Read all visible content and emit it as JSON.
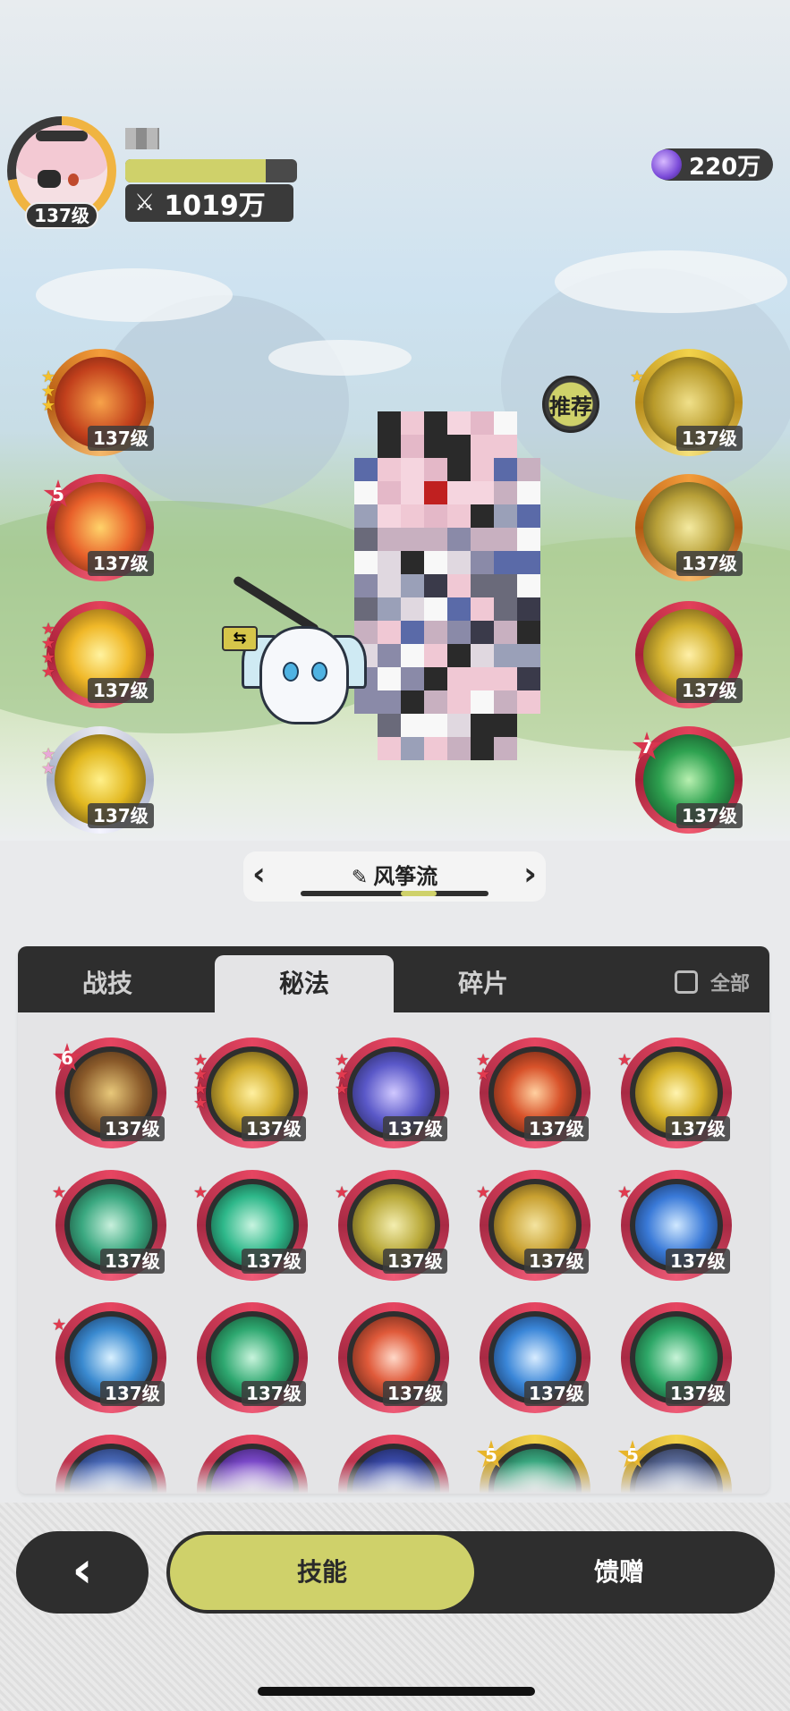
{
  "player": {
    "level": "137级",
    "power": "1019万",
    "exp_fraction": 0.82
  },
  "currency": {
    "amount": "220万",
    "icon": "purple-gem-icon"
  },
  "recommend_label": "推荐",
  "left_skills": [
    {
      "level": "137级",
      "stars": 3,
      "star_color": "gold",
      "badge": ""
    },
    {
      "level": "137级",
      "stars": 0,
      "star_color": "red",
      "badge": "5"
    },
    {
      "level": "137级",
      "stars": 4,
      "star_color": "red",
      "badge": ""
    },
    {
      "level": "137级",
      "stars": 2,
      "star_color": "pink",
      "badge": ""
    }
  ],
  "right_skills": [
    {
      "level": "137级",
      "stars": 1,
      "star_color": "gold",
      "badge": ""
    },
    {
      "level": "137级",
      "stars": 0,
      "star_color": "",
      "badge": ""
    },
    {
      "level": "137级",
      "stars": 0,
      "star_color": "",
      "badge": ""
    },
    {
      "level": "137级",
      "stars": 0,
      "star_color": "",
      "badge": "7"
    }
  ],
  "build": {
    "name": "风筝流"
  },
  "tabs": [
    "战技",
    "秘法",
    "碎片"
  ],
  "active_tab": "秘法",
  "filter_label": "全部",
  "grid": [
    [
      "137级",
      "137级",
      "137级",
      "137级",
      "137级"
    ],
    [
      "137级",
      "137级",
      "137级",
      "137级",
      "137级"
    ],
    [
      "137级",
      "137级",
      "137级",
      "137级",
      "137级"
    ]
  ],
  "grid_badges": {
    "r0c0": "6",
    "r3c3": "5",
    "r3c4": "5"
  },
  "bottom": {
    "active": "技能",
    "inactive": "馈赠"
  },
  "colors": {
    "accent": "#cfd16a",
    "dark": "#2e2e2e",
    "ring_red": "#e64561"
  }
}
